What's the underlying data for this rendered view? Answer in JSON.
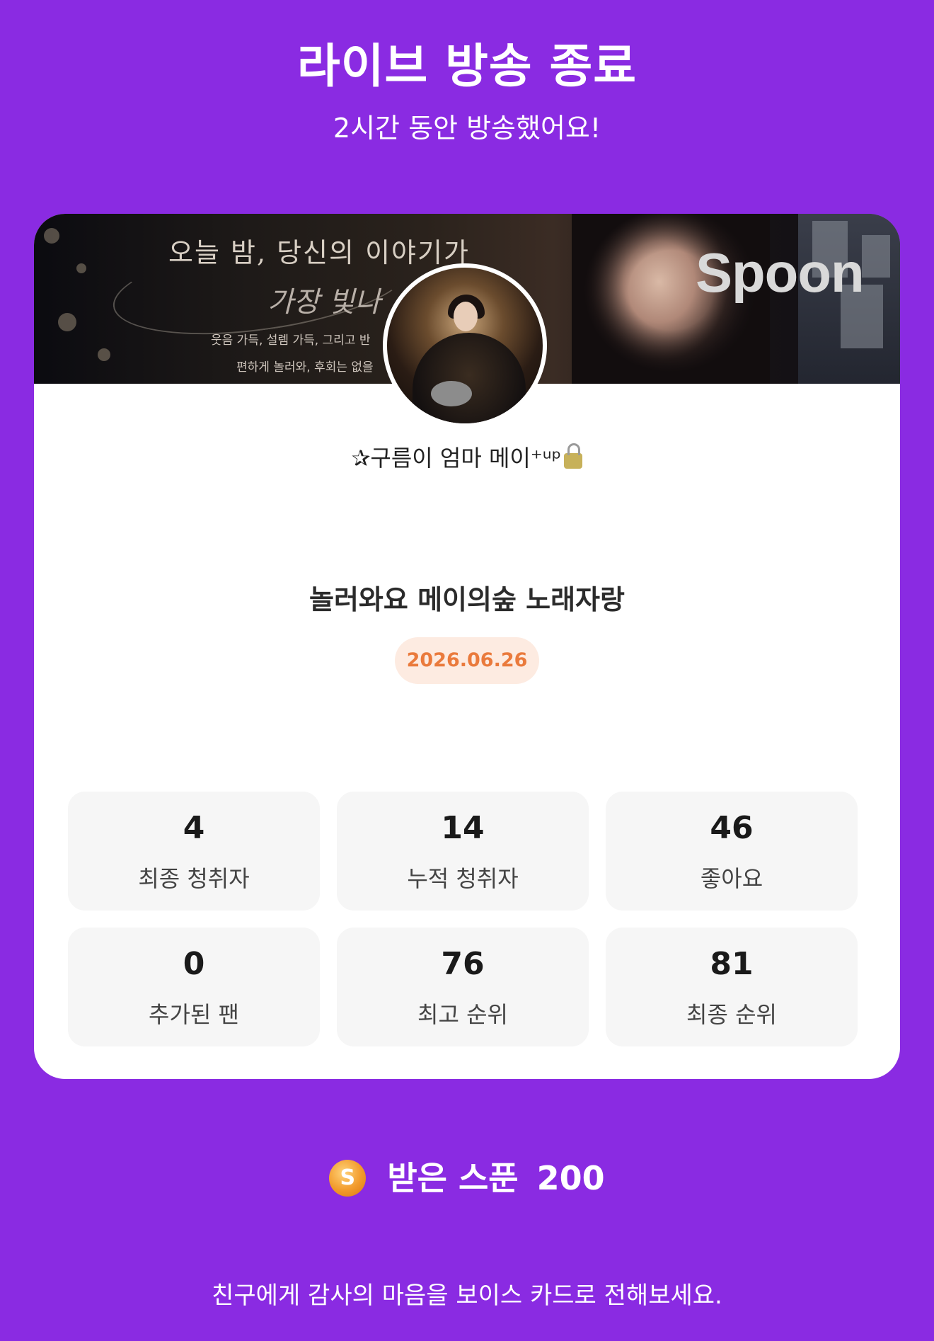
{
  "header": {
    "title": "라이브 방송 종료",
    "subtitle": "2시간 동안 방송했어요!"
  },
  "card": {
    "banner": {
      "headline": "오늘 밤, 당신의 이야기가",
      "headline2": "가장 빛나",
      "line3": "웃음 가득, 설렘 가득, 그리고 반",
      "line4": "편하게 놀러와, 후회는 없을",
      "logo": "Spoon"
    },
    "nickname": "✰구름이 엄마 메이⁺ᵘᵖ",
    "live_title": "놀러와요 메이의숲 노래자랑",
    "date": "2026.06.26",
    "stats": [
      {
        "value": "4",
        "label": "최종 청취자"
      },
      {
        "value": "14",
        "label": "누적 청취자"
      },
      {
        "value": "46",
        "label": "좋아요"
      },
      {
        "value": "0",
        "label": "추가된 팬"
      },
      {
        "value": "76",
        "label": "최고 순위"
      },
      {
        "value": "81",
        "label": "최종 순위"
      }
    ]
  },
  "received": {
    "coin_letter": "S",
    "label": "받은 스푼",
    "amount": "200"
  },
  "footer": {
    "text": "친구에게 감사의 마음을 보이스 카드로 전해보세요."
  },
  "colors": {
    "background": "#8a2be2",
    "date_text": "#ea7a3c",
    "date_bg": "#fdebe1",
    "coin": "#f29a2b"
  }
}
